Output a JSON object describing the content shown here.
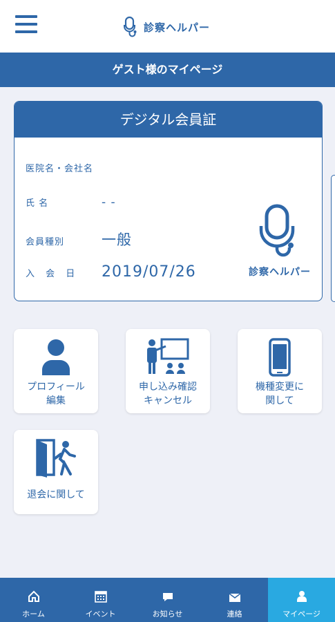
{
  "header": {
    "app_name": "診察ヘルパー"
  },
  "page_title": "ゲスト様のマイページ",
  "member_card": {
    "title": "デジタル会員証",
    "fields": [
      {
        "label": "医院名・会社名",
        "value": ""
      },
      {
        "label": "氏 名",
        "value": "- -"
      },
      {
        "label": "会員種別",
        "value": "一般"
      },
      {
        "label": "入 会 日",
        "value": "2019/07/26"
      }
    ],
    "logo_text": "診察ヘルパー"
  },
  "tiles": [
    {
      "label": "プロフィール\n編集",
      "icon": "person-icon"
    },
    {
      "label": "申し込み確認\nキャンセル",
      "icon": "presentation-icon"
    },
    {
      "label": "機種変更に\n関して",
      "icon": "smartphone-icon"
    },
    {
      "label": "退会に関して",
      "icon": "exit-icon"
    }
  ],
  "bottom_nav": [
    {
      "label": "ホーム",
      "icon": "home-icon"
    },
    {
      "label": "イベント",
      "icon": "calendar-icon"
    },
    {
      "label": "お知らせ",
      "icon": "chat-icon"
    },
    {
      "label": "連絡",
      "icon": "mail-icon"
    },
    {
      "label": "マイページ",
      "icon": "user-icon",
      "active": true
    }
  ],
  "colors": {
    "primary": "#2e67a8",
    "active_tab": "#29a9e1",
    "background": "#eef0f7"
  }
}
